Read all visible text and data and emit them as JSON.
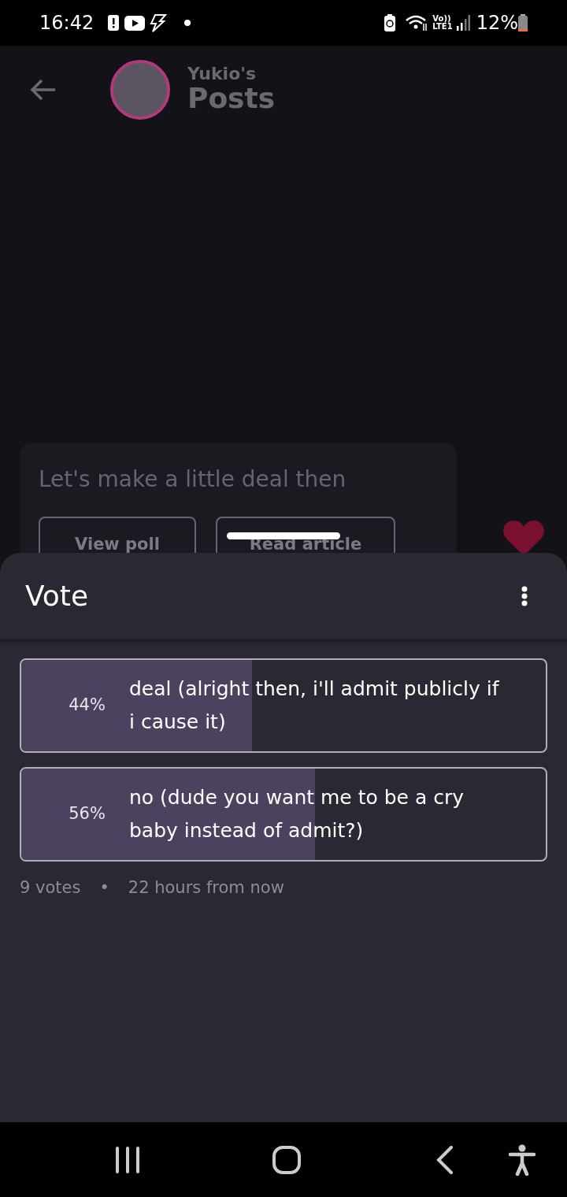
{
  "status_bar": {
    "time": "16:42",
    "network_top": "Vo))",
    "network_bottom": "LTE1",
    "battery": "12%"
  },
  "header": {
    "subtitle": "Yukio's",
    "title": "Posts"
  },
  "post": {
    "title": "Let's make a little deal then",
    "buttons": [
      "View poll",
      "Read article"
    ],
    "liked": true
  },
  "sheet": {
    "title": "Vote",
    "options": [
      {
        "percent": "44%",
        "text": "deal (alright then, i'll admit publicly if i cause it)",
        "level": 0.44
      },
      {
        "percent": "56%",
        "text": "no (dude you want me to be a cry baby instead of admit?)",
        "level": 0.56
      }
    ],
    "votes": "9 votes",
    "separator": "•",
    "time_left": "22 hours from now"
  }
}
